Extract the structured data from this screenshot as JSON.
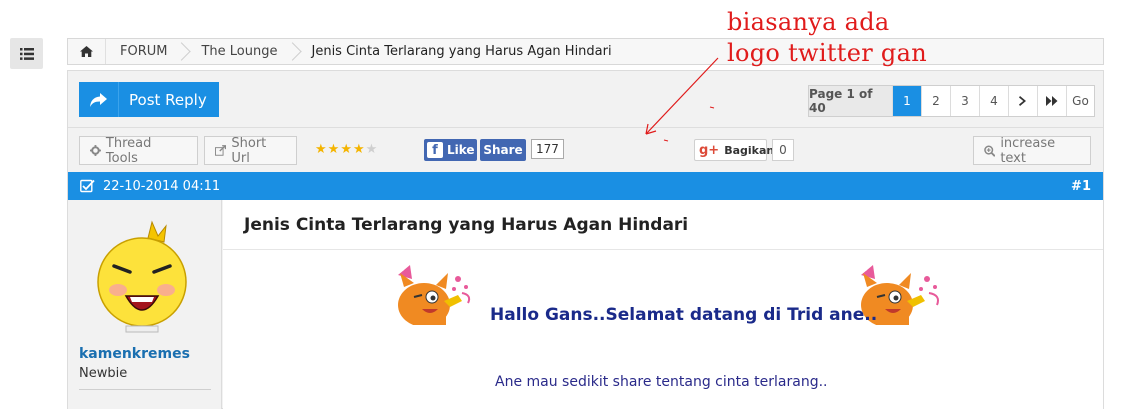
{
  "breadcrumb": {
    "home_icon": "home-icon",
    "items": [
      "FORUM",
      "The Lounge",
      "Jenis Cinta Terlarang yang Harus Agan Hindari"
    ]
  },
  "annotation": {
    "line1": "biasanya ada",
    "line2": "logo twitter gan",
    "color": "#e01b1b"
  },
  "actions": {
    "post_reply": "Post Reply",
    "thread_tools": "Thread Tools",
    "short_url": "Short Url",
    "increase_text": "increase text"
  },
  "rating": {
    "stars": 4,
    "max": 5
  },
  "social": {
    "fb_like": "Like",
    "fb_share": "Share",
    "fb_count": "177",
    "gplus_label": "Bagikan",
    "gplus_count": "0"
  },
  "pager": {
    "info": "Page 1 of 40",
    "pages": [
      "1",
      "2",
      "3",
      "4"
    ],
    "current": "1",
    "go": "Go"
  },
  "post": {
    "date": "22-10-2014 04:11",
    "number": "#1",
    "username": "kamenkremes",
    "user_title": "Newbie",
    "title": "Jenis Cinta Terlarang yang Harus Agan Hindari",
    "greeting": "Hallo Gans..Selamat datang di Trid ane..",
    "intro": "Ane mau sedikit share tentang cinta terlarang.."
  },
  "colors": {
    "accent": "#1a8fe3",
    "facebook": "#4267b2",
    "link": "#1a6fb0"
  }
}
